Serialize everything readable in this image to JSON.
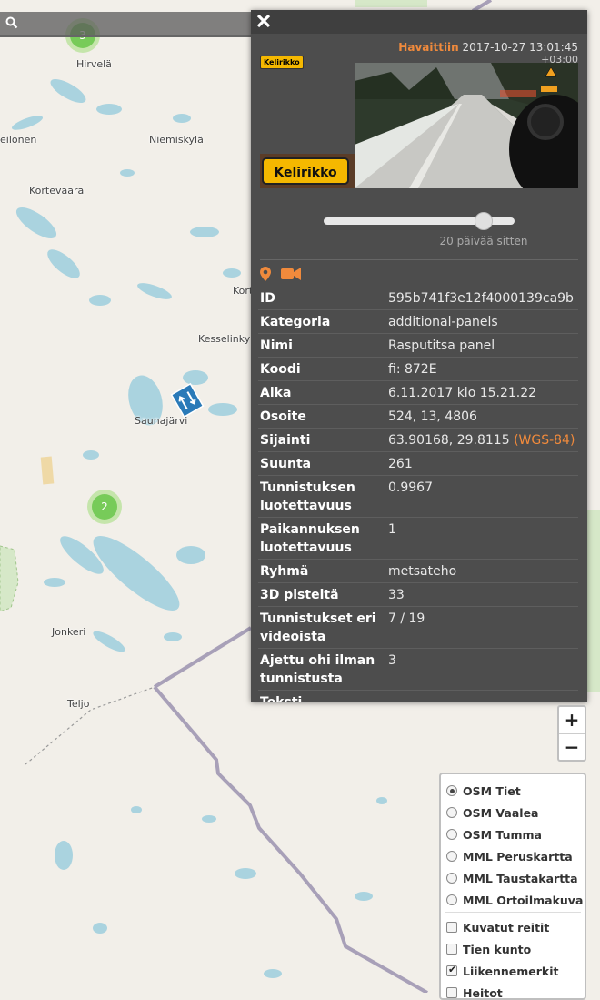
{
  "map": {
    "places": [
      {
        "id": "hirvela",
        "label": "Hirvelä"
      },
      {
        "id": "eilonen",
        "label": "eilonen"
      },
      {
        "id": "niemiskyla",
        "label": "Niemiskylä"
      },
      {
        "id": "kortevaara",
        "label": "Kortevaara"
      },
      {
        "id": "kort",
        "label": "Kort"
      },
      {
        "id": "kesselinky",
        "label": "Kesselinky"
      },
      {
        "id": "saunajarvi",
        "label": "Saunajärvi"
      },
      {
        "id": "jonkeri",
        "label": "Jonkeri"
      },
      {
        "id": "teljo",
        "label": "Teljo"
      }
    ],
    "clusters": [
      {
        "id": "top",
        "count": "3"
      },
      {
        "id": "mid",
        "count": "2"
      }
    ],
    "colors": {
      "background": "#f2efe9",
      "water": "#aad3df",
      "border": "#a8a0b8",
      "panel": "#4d4d4d",
      "accent": "#f08a3c",
      "marker": "#2a7ab8"
    }
  },
  "search": {
    "placeholder": "",
    "icon": "search-icon"
  },
  "panel": {
    "close_icon": "close-icon",
    "observed_label": "Havaittiin",
    "observed_time": "2017-10-27 13:01:45",
    "observed_tz": "+03:00",
    "sign_badge": "Kelirikko",
    "thumb_sign": "Kelirikko",
    "slider_value_percent": 84,
    "ago": "20 päivää sitten",
    "icons": [
      "location-pin-icon",
      "video-camera-icon"
    ],
    "attributes": [
      {
        "key": "ID",
        "value": "595b741f3e12f4000139ca9b"
      },
      {
        "key": "Kategoria",
        "value": "additional-panels"
      },
      {
        "key": "Nimi",
        "value": "Rasputitsa panel"
      },
      {
        "key": "Koodi",
        "value": "fi: 872E"
      },
      {
        "key": "Aika",
        "value": "6.11.2017 klo 15.21.22"
      },
      {
        "key": "Osoite",
        "value": "524, 13, 4806"
      },
      {
        "key": "Sijainti",
        "value": "63.90168, 29.8115",
        "extra": "(WGS-84)"
      },
      {
        "key": "Suunta",
        "value": "261"
      },
      {
        "key": "Tunnistuksen luotettavuus",
        "value": "0.9967"
      },
      {
        "key": "Paikannuksen luotettavuus",
        "value": "1"
      },
      {
        "key": "Ryhmä",
        "value": "metsateho"
      },
      {
        "key": "3D pisteitä",
        "value": "33"
      },
      {
        "key": "Tunnistukset eri videoista",
        "value": "7 / 19"
      },
      {
        "key": "Ajettu ohi ilman tunnistusta",
        "value": "3"
      },
      {
        "key": "Teksti",
        "value": "..."
      }
    ]
  },
  "zoom": {
    "in": "+",
    "out": "−"
  },
  "layers": {
    "base": [
      {
        "label": "OSM Tiet",
        "selected": true
      },
      {
        "label": "OSM Vaalea",
        "selected": false
      },
      {
        "label": "OSM Tumma",
        "selected": false
      },
      {
        "label": "MML Peruskartta",
        "selected": false
      },
      {
        "label": "MML Taustakartta",
        "selected": false
      },
      {
        "label": "MML Ortoilmakuva",
        "selected": false
      }
    ],
    "overlays": [
      {
        "label": "Kuvatut reitit",
        "checked": false
      },
      {
        "label": "Tien kunto",
        "checked": false
      },
      {
        "label": "Liikennemerkit",
        "checked": true
      },
      {
        "label": "Heitot",
        "checked": false
      }
    ]
  }
}
